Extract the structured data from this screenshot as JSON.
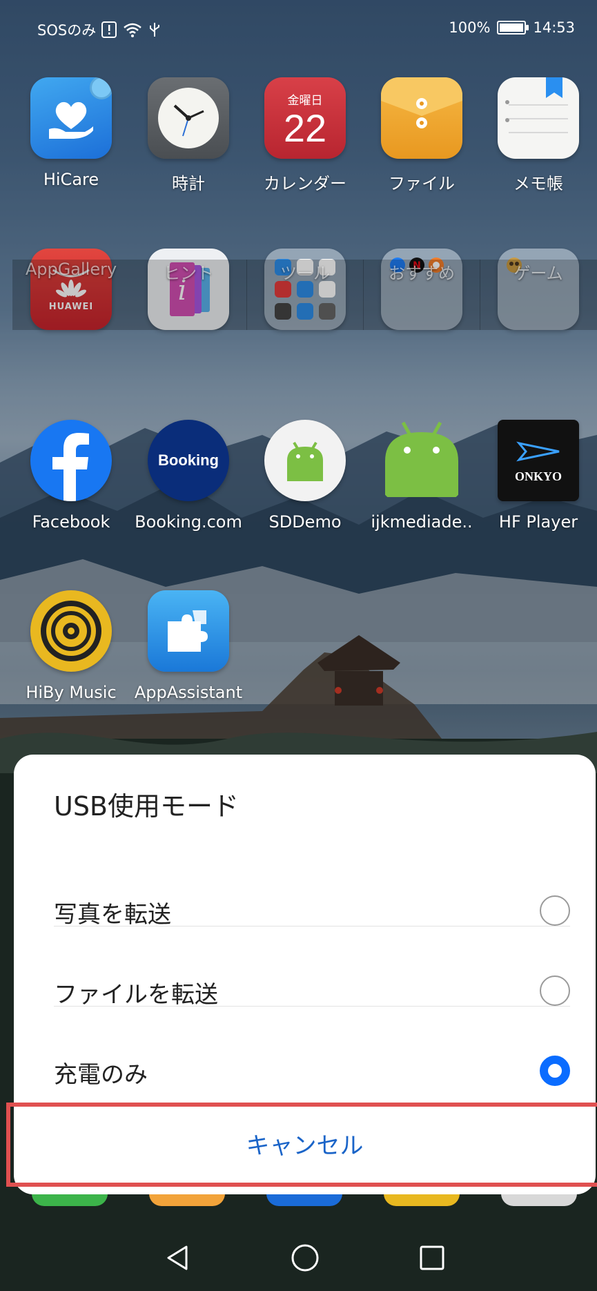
{
  "status_bar": {
    "carrier": "SOSのみ",
    "battery": "100%",
    "time": "14:53"
  },
  "apps": {
    "hicare": "HiCare",
    "clock": "時計",
    "calendar": "カレンダー",
    "calendar_weekday": "金曜日",
    "calendar_day": "22",
    "files": "ファイル",
    "memo": "メモ帳",
    "appgallery": "AppGallery",
    "huawei_logo": "HUAWEI",
    "tips": "ヒント",
    "tools": "ツール",
    "recommended": "おすすめ",
    "games": "ゲーム",
    "facebook": "Facebook",
    "booking": "Booking.com",
    "booking_logo": "Booking",
    "sddemo": "SDDemo",
    "ijkmedia": "ijkmediade..",
    "hfplayer": "HF Player",
    "onkyo_logo": "ONKYO",
    "hiby": "HiBy Music",
    "appassistant": "AppAssistant"
  },
  "dialog": {
    "title": "USB使用モード",
    "options": [
      {
        "label": "写真を転送",
        "selected": false
      },
      {
        "label": "ファイルを転送",
        "selected": false
      },
      {
        "label": "充電のみ",
        "selected": true
      }
    ],
    "cancel": "キャンセル"
  },
  "colors": {
    "accent": "#0a6cff",
    "cancel_text": "#1a64c8",
    "highlight_border": "#e05050"
  }
}
